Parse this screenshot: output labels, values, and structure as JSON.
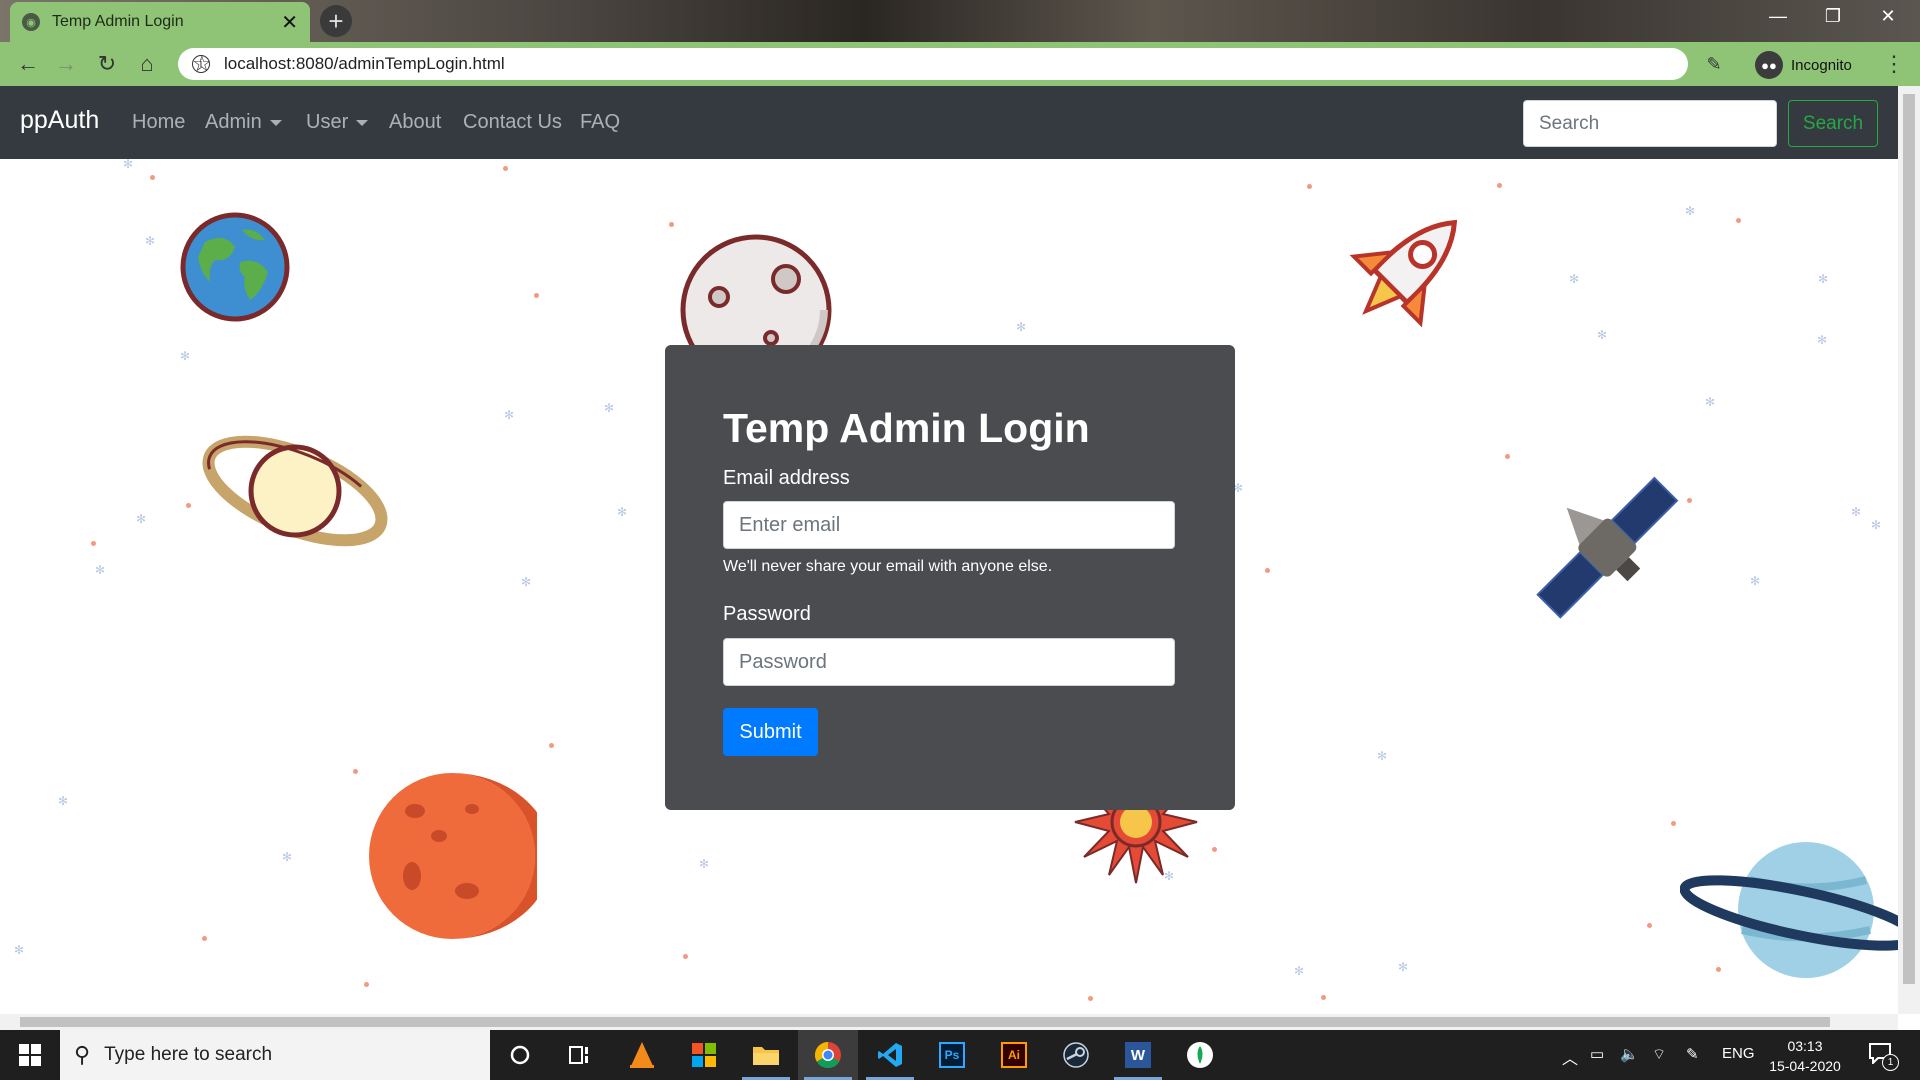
{
  "browser": {
    "tab_title": "Temp Admin Login",
    "tab_close": "✕",
    "new_tab": "+",
    "url": "localhost:8080/adminTempLogin.html",
    "profile_label": "Incognito",
    "window_controls": {
      "minimize": "—",
      "restore": "❐",
      "close": "✕"
    }
  },
  "navbar": {
    "brand": "ppAuth",
    "links": [
      "Home",
      "Admin",
      "User",
      "About",
      "Contact Us",
      "FAQ"
    ],
    "search_placeholder": "Search",
    "search_button": "Search"
  },
  "login": {
    "title": "Temp Admin Login",
    "email_label": "Email address",
    "email_placeholder": "Enter email",
    "email_help": "We'll never share your email with anyone else.",
    "password_label": "Password",
    "password_placeholder": "Password",
    "submit": "Submit"
  },
  "taskbar": {
    "search_placeholder": "Type here to search",
    "apps": [
      "cortana",
      "task-view",
      "vlc",
      "store",
      "file-explorer",
      "chrome",
      "vscode",
      "photoshop",
      "illustrator",
      "steam",
      "word",
      "mongodb"
    ],
    "photoshop_label": "Ps",
    "illustrator_label": "Ai",
    "word_label": "W",
    "language": "ENG",
    "time": "03:13",
    "date": "15-04-2020",
    "notification_count": "1"
  },
  "colors": {
    "navbar_bg": "#343a40",
    "card_bg": "#4a4c50",
    "primary": "#007bff",
    "success": "#28a745",
    "chrome_green": "#8fc476"
  }
}
